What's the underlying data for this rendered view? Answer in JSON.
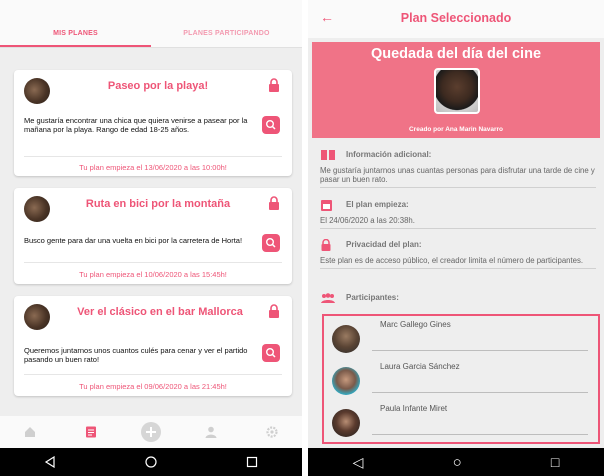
{
  "left": {
    "tabs": [
      {
        "label": "MIS PLANES",
        "active": true
      },
      {
        "label": "PLANES PARTICIPANDO",
        "active": false
      }
    ],
    "plans": [
      {
        "title": "Paseo por la playa!",
        "description": "Me gustaría encontrar una chica que quiera venirse a pasear por la mañana por la playa. Rango de edad 18-25 años.",
        "starts": "Tu plan empieza el 13/06/2020 a las 10:00h!"
      },
      {
        "title": "Ruta en bici por la montaña",
        "description": "Busco gente para dar una vuelta en bici por la carretera de Horta!",
        "starts": "Tu plan empieza el 10/06/2020 a las 15:45h!"
      },
      {
        "title": "Ver el clásico en el bar Mallorca",
        "description": "Queremos juntarnos unos cuantos culés para cenar y ver el partido pasando un buen rato!",
        "starts": "Tu plan empieza el 09/06/2020 a las 21:45h!"
      }
    ],
    "bottom_nav": [
      "home-icon",
      "plans-icon",
      "add-icon",
      "profile-icon",
      "settings-icon"
    ]
  },
  "right": {
    "appbar_title": "Plan Seleccionado",
    "back_icon": "←",
    "hero": {
      "title": "Quedada del día del cine",
      "creator": "Creado por Ana Marin Navarro"
    },
    "info": {
      "heading": "Información adicional:",
      "body": "Me gustaría juntarnos unas cuantas personas para disfrutar una tarde de cine y pasar un buen rato."
    },
    "start": {
      "heading": "El plan empieza:",
      "body": "El 24/06/2020 a las 20:38h."
    },
    "privacy": {
      "heading": "Privacidad del plan:",
      "body": "Este plan es de acceso público, el creador limita el número de participantes."
    },
    "participants": {
      "heading": "Participantes:",
      "list": [
        "Marc Gallego Gines",
        "Laura Garcia Sánchez",
        "Paula Infante Miret"
      ]
    }
  },
  "system_nav": {
    "back": "◁",
    "home": "○",
    "recents": "□"
  },
  "colors": {
    "accent": "#ee5577",
    "hero": "#f07387",
    "background": "#eeeeee"
  }
}
